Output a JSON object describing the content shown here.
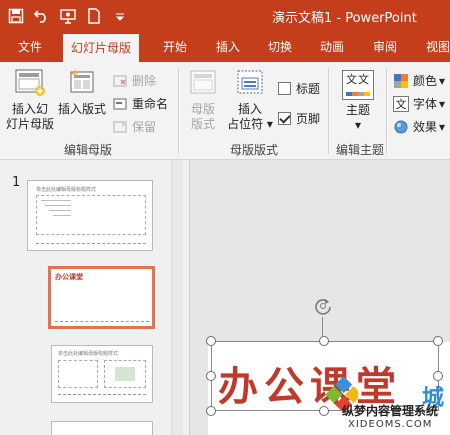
{
  "window": {
    "title": "演示文稿1 - PowerPoint"
  },
  "qat": {
    "icons": [
      "save-icon",
      "undo-icon",
      "slideshow-icon",
      "new-file-icon",
      "customize-icon"
    ]
  },
  "tabs": [
    "文件",
    "幻灯片母版",
    "开始",
    "插入",
    "切换",
    "动画",
    "审阅",
    "视图"
  ],
  "ribbon": {
    "edit_master": {
      "insert_master_line1": "插入幻",
      "insert_master_line2": "灯片母版",
      "insert_layout": "插入版式",
      "delete": "删除",
      "rename": "重命名",
      "preserve": "保留",
      "label": "编辑母版"
    },
    "master_layout": {
      "master_layout_line1": "母版",
      "master_layout_line2": "版式",
      "insert_placeholder_line1": "插入",
      "insert_placeholder_line2": "占位符",
      "title_check": "标题",
      "footer_check": "页脚",
      "label": "母版版式"
    },
    "edit_theme": {
      "themes": "主题",
      "theme_icon_text": "文文",
      "colors": "颜色",
      "fonts": "字体",
      "effects": "效果",
      "fonts_icon_text": "文",
      "label": "编辑主题"
    }
  },
  "thumbnails": {
    "slide_number": "1",
    "master_title": "单击此处编辑母版标题样式",
    "selected_layout_title": "办公课堂"
  },
  "slide": {
    "title_text": "办公课堂"
  },
  "watermark": {
    "text": "纵梦内容管理系统",
    "url": "XIDEOMS.COM",
    "partial_char": "城"
  },
  "colors": {
    "accent": "#c43e1c",
    "selected_thumb": "#e2734f"
  }
}
